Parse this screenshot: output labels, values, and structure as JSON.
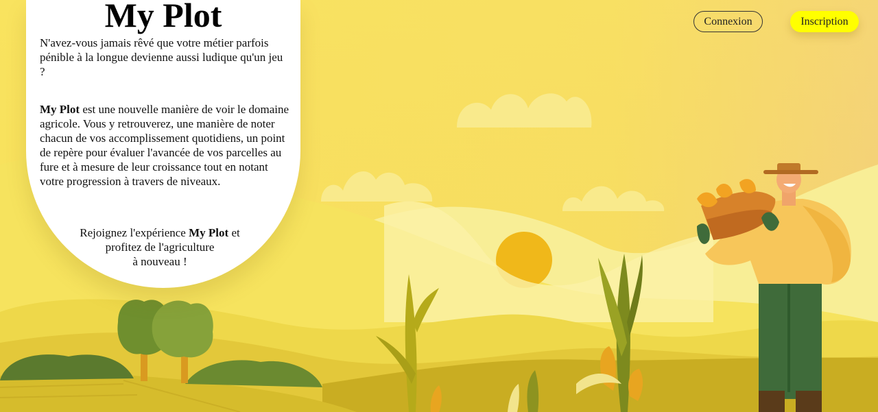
{
  "card": {
    "title": "My Plot",
    "intro": "N'avez-vous jamais rêvé que votre métier parfois pénible à la longue devienne aussi ludique qu'un jeu ?",
    "desc_brand": "My Plot",
    "desc_rest": " est une nouvelle manière de voir le domaine agricole. Vous y retrouverez, une manière de noter chacun de vos accomplissement quotidiens, un point de repère pour évaluer l'avancée de vos parcelles au fure et à mesure de leur croissance tout en notant votre progression à travers de niveaux.",
    "join_start": "Rejoignez l'expérience ",
    "join_brand": "My Plot",
    "join_line1_end": " et",
    "join_line2": "profitez de l'agriculture",
    "join_line3": "à nouveau !"
  },
  "header": {
    "login_label": "Connexion",
    "signup_label": "Inscription"
  },
  "colors": {
    "background": "#f7de5a",
    "sun": "#f0b81a",
    "signup_button": "#ffff00"
  }
}
